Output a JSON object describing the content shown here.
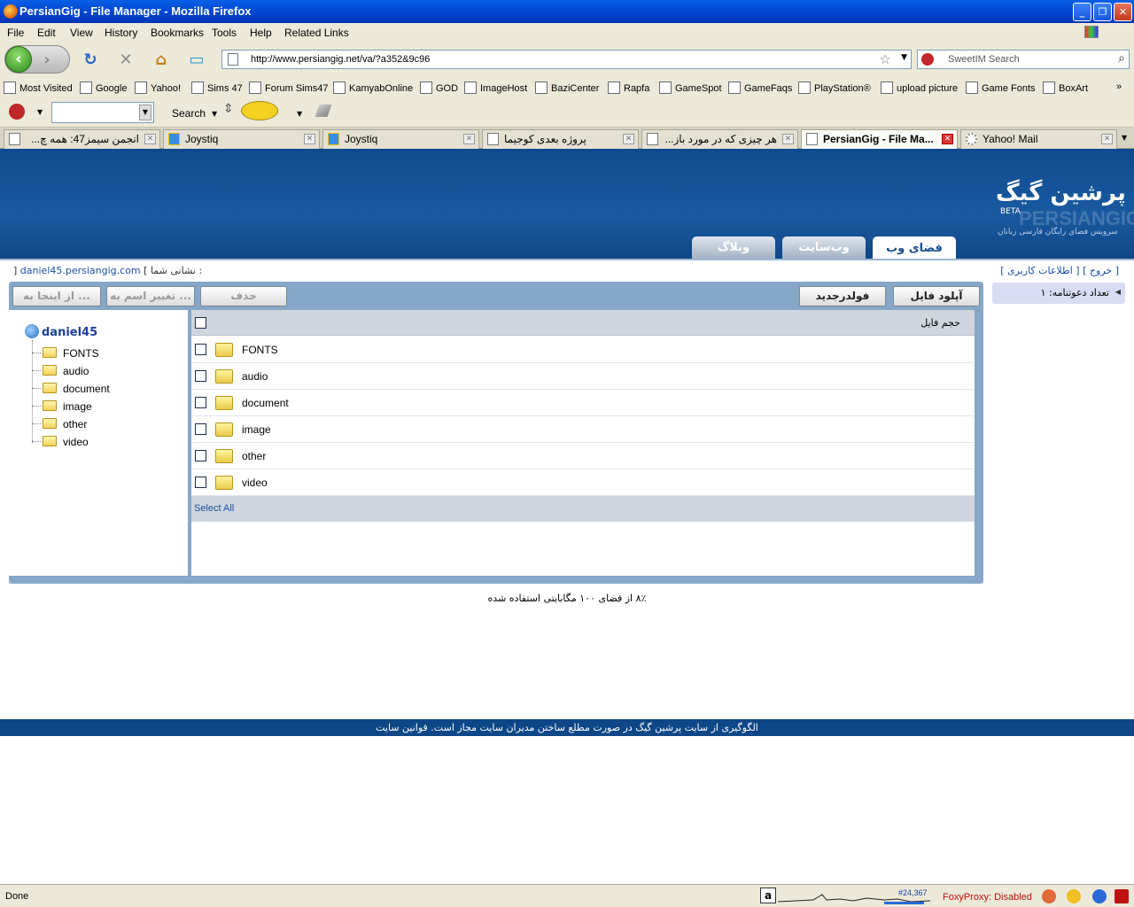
{
  "window": {
    "title": "PersianGig - File Manager - Mozilla Firefox"
  },
  "menu": [
    "File",
    "Edit",
    "View",
    "History",
    "Bookmarks",
    "Tools",
    "Help",
    "Related Links"
  ],
  "navigation": {
    "url": "http://www.persiangig.net/va/?a352&9c96",
    "search_placeholder": "SweetIM Search"
  },
  "bookmarks": [
    "Most Visited",
    "Google",
    "Yahoo!",
    "Sims 47",
    "Forum Sims47",
    "KamyabOnline",
    "GOD",
    "ImageHost",
    "BaziCenter",
    "Rapfa",
    "GameSpot",
    "GameFaqs",
    "PlayStation®",
    "upload picture",
    "Game Fonts",
    "BoxArt"
  ],
  "toolbar2": {
    "search_label": "Search"
  },
  "tabs": [
    {
      "label": "انجمن سیمز47: همه چ...",
      "active": false
    },
    {
      "label": "Joystiq",
      "active": false
    },
    {
      "label": "Joystiq",
      "active": false
    },
    {
      "label": "پروژه بعدی کوجیما",
      "active": false
    },
    {
      "label": "هر چیزی که در مورد باز...",
      "active": false
    },
    {
      "label": "PersianGig - File Ma...",
      "active": true
    },
    {
      "label": "Yahoo! Mail",
      "active": false
    }
  ],
  "site": {
    "logo_text": "پرشین گیگ",
    "logo_beta": "BETA",
    "logo_latin": "PERSIANGIG",
    "logo_tagline": "سرویس فضای رایگان فارسی زبانان",
    "nav_tabs": [
      "فضای وب",
      "وب‌سایت",
      "وبلاگ"
    ],
    "address_label": "[ نشانی شما :",
    "address_value": "daniel45.persiangig.com",
    "address_close": "]",
    "user_links": [
      "[ خروج ]",
      "[ اطلاعات کاربری ]"
    ],
    "invite_label": "تعداد دعوتنامه: ۱"
  },
  "file_manager": {
    "buttons": {
      "upload": "آپلود فایل",
      "new_folder": "فولدرجدید",
      "delete": "حذف",
      "rename": "تغییر اسم به ...",
      "move": "از اینجا به ..."
    },
    "tree_root": "daniel45",
    "column_header": "حجم فایل",
    "items": [
      "FONTS",
      "audio",
      "document",
      "image",
      "other",
      "video"
    ],
    "select_all": "Select All"
  },
  "usage_text": "۸٪ از فضای ۱۰۰ مگابایتی استفاده شده",
  "footer_text": "الگوگیری از سایت پرشین گیگ در صورت مطلع ساختن مدیران سایت مجاز است. قوانین سایت",
  "status": {
    "text": "Done",
    "alexa_rank": "#24,367",
    "foxyproxy": "FoxyProxy: Disabled"
  }
}
